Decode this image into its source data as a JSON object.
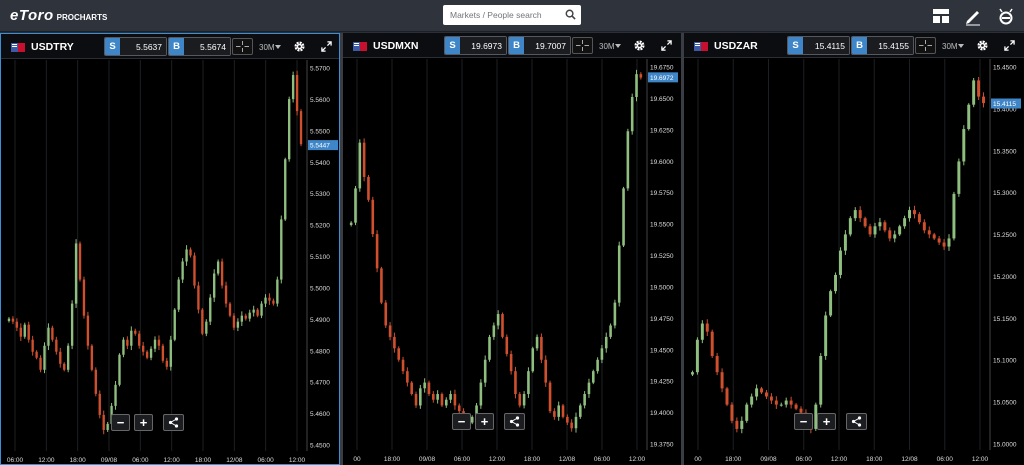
{
  "app": {
    "logo": "eToro",
    "logo_sub": "PROCHARTS"
  },
  "search": {
    "placeholder": "Markets / People search"
  },
  "icons": {
    "layout": "layout-grid-icon",
    "edit": "pencil-icon",
    "profile": "etoro-e-icon",
    "search": "magnifier-icon"
  },
  "colors": {
    "bull": "#8fbf7f",
    "bear": "#d0502e",
    "accent": "#3f86c8",
    "background": "#000000"
  },
  "panels": [
    {
      "symbol": "USDTRY",
      "sell_label": "S",
      "sell": "5.5637",
      "buy_label": "B",
      "buy": "5.5674",
      "timeframe": "30M",
      "price_label": "5.5447",
      "y_ticks": [
        "5.5700",
        "5.5600",
        "5.5500",
        "5.5400",
        "5.5300",
        "5.5200",
        "5.5100",
        "5.5000",
        "5.4900",
        "5.4800",
        "5.4700",
        "5.4600",
        "5.4500"
      ],
      "x_ticks": [
        "06:00",
        "12:00",
        "18:00",
        "09/08",
        "06:00",
        "12:00",
        "18:00",
        "12/08",
        "06:00",
        "12:00"
      ]
    },
    {
      "symbol": "USDMXN",
      "sell_label": "S",
      "sell": "19.6973",
      "buy_label": "B",
      "buy": "19.7007",
      "timeframe": "30M",
      "price_label": "19.6972",
      "y_ticks": [
        "19.6750",
        "19.6500",
        "19.6250",
        "19.6000",
        "19.5750",
        "19.5500",
        "19.5250",
        "19.5000",
        "19.4750",
        "19.4500",
        "19.4250",
        "19.4000",
        "19.3750"
      ],
      "x_ticks": [
        "00",
        "18:00",
        "09/08",
        "06:00",
        "12:00",
        "18:00",
        "12/08",
        "06:00",
        "12:00"
      ]
    },
    {
      "symbol": "USDZAR",
      "sell_label": "S",
      "sell": "15.4115",
      "buy_label": "B",
      "buy": "15.4155",
      "timeframe": "30M",
      "price_label": "15.4115",
      "y_ticks": [
        "15.4500",
        "15.4000",
        "15.3500",
        "15.3000",
        "15.2500",
        "15.2000",
        "15.1500",
        "15.1000",
        "15.0500",
        "15.0000"
      ],
      "x_ticks": [
        "00",
        "18:00",
        "09/08",
        "06:00",
        "12:00",
        "18:00",
        "12/08",
        "06:00",
        "12:00"
      ]
    }
  ],
  "chart_data": [
    {
      "type": "candlestick",
      "symbol": "USDTRY",
      "timeframe": "30M",
      "ylim": [
        5.443,
        5.571
      ],
      "x_ticks": [
        "06:00",
        "12:00",
        "18:00",
        "09/08",
        "06:00",
        "12:00",
        "18:00",
        "12/08",
        "06:00",
        "12:00"
      ],
      "close_path": [
        5.487,
        5.486,
        5.484,
        5.481,
        5.485,
        5.48,
        5.476,
        5.474,
        5.47,
        5.478,
        5.484,
        5.48,
        5.476,
        5.472,
        5.47,
        5.478,
        5.492,
        5.512,
        5.5,
        5.488,
        5.478,
        5.47,
        5.462,
        5.455,
        5.45,
        5.452,
        5.458,
        5.465,
        5.475,
        5.48,
        5.478,
        5.483,
        5.482,
        5.478,
        5.476,
        5.474,
        5.477,
        5.48,
        5.478,
        5.473,
        5.471,
        5.48,
        5.49,
        5.5,
        5.506,
        5.51,
        5.508,
        5.498,
        5.49,
        5.482,
        5.486,
        5.494,
        5.502,
        5.506,
        5.498,
        5.492,
        5.488,
        5.484,
        5.486,
        5.488,
        5.487,
        5.489,
        5.49,
        5.488,
        5.492,
        5.494,
        5.493,
        5.492,
        5.5,
        5.52,
        5.54,
        5.56,
        5.568,
        5.556,
        5.545
      ]
    },
    {
      "type": "candlestick",
      "symbol": "USDMXN",
      "timeframe": "30M",
      "ylim": [
        19.371,
        19.708
      ],
      "x_ticks": [
        "00",
        "18:00",
        "09/08",
        "06:00",
        "12:00",
        "18:00",
        "12/08",
        "06:00",
        "12:00"
      ],
      "close_path": [
        19.57,
        19.6,
        19.64,
        19.61,
        19.59,
        19.56,
        19.53,
        19.5,
        19.48,
        19.47,
        19.46,
        19.45,
        19.44,
        19.43,
        19.42,
        19.41,
        19.425,
        19.43,
        19.42,
        19.415,
        19.42,
        19.41,
        19.415,
        19.42,
        19.41,
        19.405,
        19.4,
        19.395,
        19.4,
        19.41,
        19.43,
        19.45,
        19.47,
        19.48,
        19.49,
        19.47,
        19.455,
        19.44,
        19.42,
        19.41,
        19.42,
        19.44,
        19.46,
        19.47,
        19.45,
        19.43,
        19.405,
        19.4,
        19.41,
        19.4,
        19.395,
        19.39,
        19.4,
        19.41,
        19.42,
        19.43,
        19.44,
        19.45,
        19.46,
        19.47,
        19.48,
        19.5,
        19.55,
        19.6,
        19.65,
        19.68,
        19.7,
        19.697
      ]
    },
    {
      "type": "candlestick",
      "symbol": "USDZAR",
      "timeframe": "30M",
      "ylim": [
        14.984,
        15.459
      ],
      "x_ticks": [
        "00",
        "18:00",
        "09/08",
        "06:00",
        "12:00",
        "18:00",
        "12/08",
        "06:00",
        "12:00"
      ],
      "close_path": [
        15.08,
        15.12,
        15.14,
        15.13,
        15.1,
        15.08,
        15.06,
        15.04,
        15.02,
        15.01,
        15.02,
        15.04,
        15.05,
        15.06,
        15.055,
        15.05,
        15.045,
        15.04,
        15.04,
        15.045,
        15.04,
        15.035,
        15.03,
        15.02,
        15.01,
        15.04,
        15.1,
        15.15,
        15.18,
        15.2,
        15.23,
        15.25,
        15.27,
        15.28,
        15.27,
        15.26,
        15.25,
        15.26,
        15.265,
        15.255,
        15.245,
        15.25,
        15.26,
        15.27,
        15.28,
        15.275,
        15.265,
        15.255,
        15.25,
        15.245,
        15.24,
        15.235,
        15.245,
        15.3,
        15.34,
        15.38,
        15.41,
        15.44,
        15.42,
        15.412
      ]
    }
  ]
}
